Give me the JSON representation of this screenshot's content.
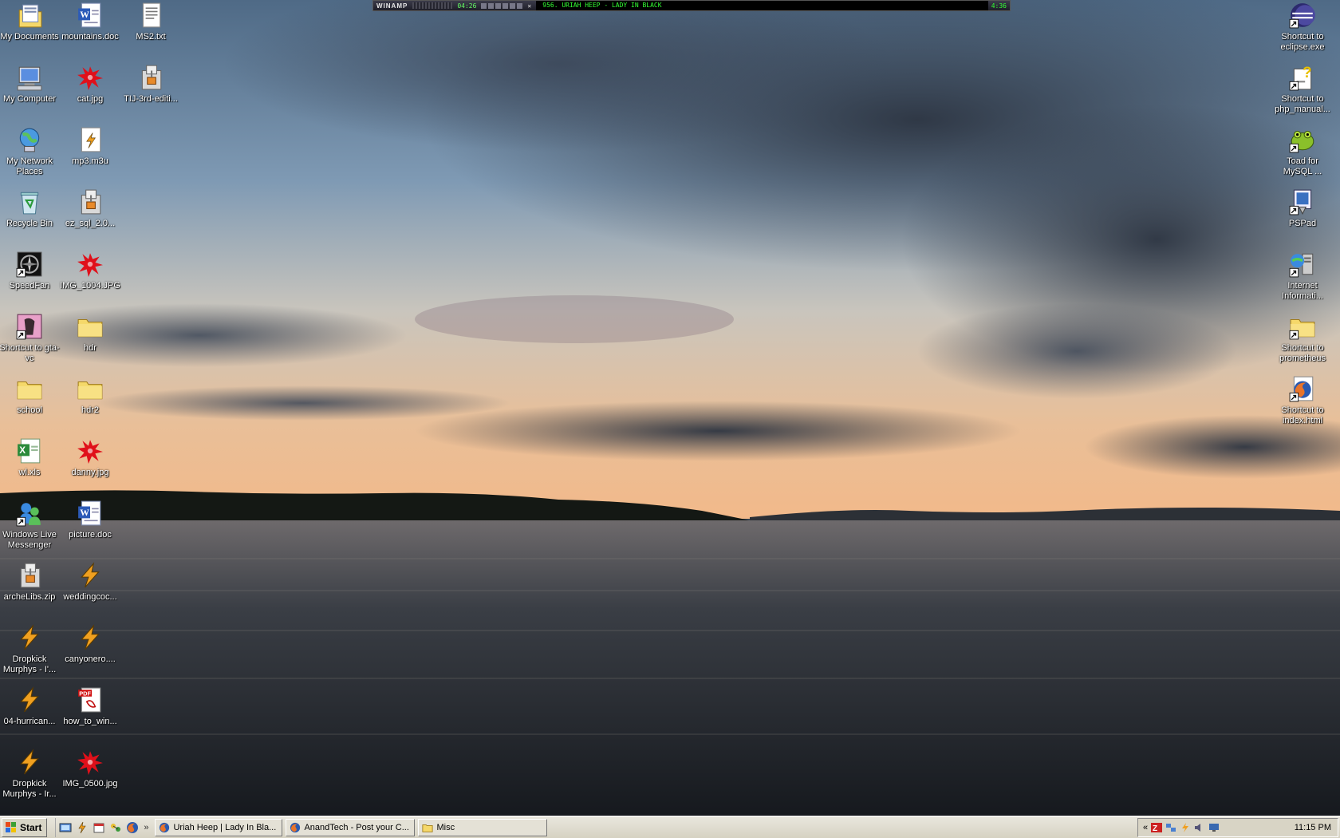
{
  "desktop": {
    "left_icons": [
      {
        "label": "My Documents",
        "icon": "my-documents-icon"
      },
      {
        "label": "mountains.doc",
        "icon": "word-doc-icon"
      },
      {
        "label": "MS2.txt",
        "icon": "text-file-icon"
      },
      {
        "label": "My Computer",
        "icon": "my-computer-icon"
      },
      {
        "label": "cat.jpg",
        "icon": "image-splat-icon"
      },
      {
        "label": "TIJ-3rd-editi...",
        "icon": "archive-icon"
      },
      {
        "label": "My Network Places",
        "icon": "network-places-icon"
      },
      {
        "label": "mp3.m3u",
        "icon": "playlist-icon"
      },
      {
        "label": "Recycle Bin",
        "icon": "recycle-bin-icon"
      },
      {
        "label": "ez_sql_2.0...",
        "icon": "archive-icon"
      },
      {
        "label": "SpeedFan",
        "icon": "speedfan-icon"
      },
      {
        "label": "IMG_1004.JPG",
        "icon": "image-splat-icon"
      },
      {
        "label": "Shortcut to gta-vc",
        "icon": "game-shortcut-icon"
      },
      {
        "label": "hdr",
        "icon": "folder-icon"
      },
      {
        "label": "school",
        "icon": "folder-icon"
      },
      {
        "label": "hdr2",
        "icon": "folder-icon"
      },
      {
        "label": "wl.xls",
        "icon": "excel-icon"
      },
      {
        "label": "danny.jpg",
        "icon": "image-splat-icon"
      },
      {
        "label": "Windows Live Messenger",
        "icon": "messenger-icon"
      },
      {
        "label": "picture.doc",
        "icon": "word-doc-icon"
      },
      {
        "label": "archeLibs.zip",
        "icon": "archive-icon"
      },
      {
        "label": "weddingcoc...",
        "icon": "winamp-media-icon"
      },
      {
        "label": "Dropkick Murphys - I'...",
        "icon": "winamp-media-icon"
      },
      {
        "label": "canyonero....",
        "icon": "winamp-media-icon"
      },
      {
        "label": "04-hurrican...",
        "icon": "winamp-media-icon"
      },
      {
        "label": "how_to_win...",
        "icon": "pdf-icon"
      },
      {
        "label": "Dropkick Murphys - Ir...",
        "icon": "winamp-media-icon"
      },
      {
        "label": "IMG_0500.jpg",
        "icon": "image-splat-icon"
      }
    ],
    "right_icons": [
      {
        "label": "Shortcut to eclipse.exe",
        "icon": "eclipse-icon"
      },
      {
        "label": "Shortcut to php_manual...",
        "icon": "help-file-icon"
      },
      {
        "label": "Toad for MySQL ...",
        "icon": "toad-icon"
      },
      {
        "label": "PSPad",
        "icon": "pspad-icon"
      },
      {
        "label": "Internet Informati...",
        "icon": "iis-icon"
      },
      {
        "label": "Shortcut to prometheus",
        "icon": "folder-icon"
      },
      {
        "label": "Shortcut to index.html",
        "icon": "firefox-html-icon"
      }
    ]
  },
  "winamp": {
    "logo": "WINAMP",
    "time": "04:26",
    "track": "956. URIAH HEEP - LADY IN BLACK",
    "track_length": "4:36"
  },
  "taskbar": {
    "start_label": "Start",
    "tasks": [
      {
        "label": "Uriah Heep | Lady In Bla...",
        "icon": "firefox-icon"
      },
      {
        "label": "AnandTech - Post your C...",
        "icon": "firefox-icon"
      },
      {
        "label": "Misc",
        "icon": "folder-icon"
      }
    ],
    "chevron": "»",
    "tray_chevron": "«",
    "clock": "11:15 PM"
  },
  "colors": {
    "folder": "#f5d86a",
    "splat": "#e0101a",
    "taskbar": "#d8d4c5"
  }
}
